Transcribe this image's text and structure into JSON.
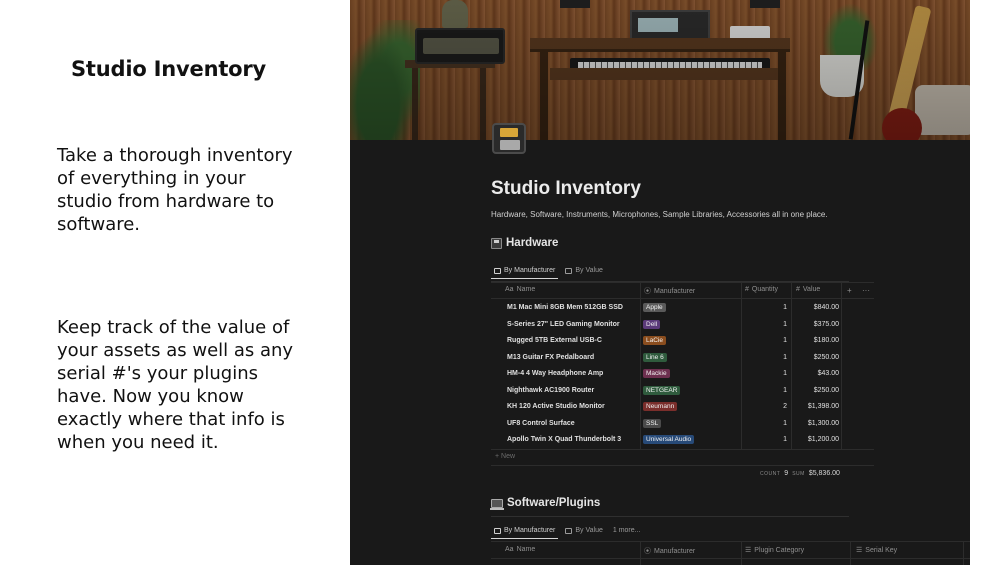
{
  "left": {
    "title": "Studio Inventory",
    "paragraph1": "Take a thorough inventory of everything in your studio from hardware to software.",
    "paragraph2": "Keep track of the value of your assets as well as any serial #'s your plugins have. Now you know exactly where that info is when you need it."
  },
  "page": {
    "title": "Studio Inventory",
    "description": "Hardware, Software, Instruments, Microphones, Sample Libraries, Accessories all in one place."
  },
  "hardware": {
    "heading": "Hardware",
    "tabs": [
      {
        "label": "By Manufacturer",
        "active": true
      },
      {
        "label": "By Value",
        "active": false
      }
    ],
    "columns": {
      "name": "Name",
      "manufacturer": "Manufacturer",
      "quantity": "Quantity",
      "value": "Value"
    },
    "rows": [
      {
        "name": "M1 Mac Mini 8GB Mem 512GB SSD",
        "manufacturer": "Apple",
        "tag_color": "#5a5a5a",
        "quantity": "1",
        "value": "$840.00"
      },
      {
        "name": "S-Series 27\" LED Gaming Monitor",
        "manufacturer": "Dell",
        "tag_color": "#5b3a7a",
        "quantity": "1",
        "value": "$375.00"
      },
      {
        "name": "Rugged 5TB External USB-C",
        "manufacturer": "LaCie",
        "tag_color": "#8a4d1e",
        "quantity": "1",
        "value": "$180.00"
      },
      {
        "name": "M13 Guitar FX Pedalboard",
        "manufacturer": "Line 6",
        "tag_color": "#2f5b3d",
        "quantity": "1",
        "value": "$250.00"
      },
      {
        "name": "HM-4 4 Way Headphone Amp",
        "manufacturer": "Mackie",
        "tag_color": "#6d2f4f",
        "quantity": "1",
        "value": "$43.00"
      },
      {
        "name": "Nighthawk AC1900 Router",
        "manufacturer": "NETGEAR",
        "tag_color": "#2f5b3d",
        "quantity": "1",
        "value": "$250.00"
      },
      {
        "name": "KH 120 Active Studio Monitor",
        "manufacturer": "Neumann",
        "tag_color": "#7a2e2b",
        "quantity": "2",
        "value": "$1,398.00"
      },
      {
        "name": "UF8 Control Surface",
        "manufacturer": "SSL",
        "tag_color": "#4a4a4a",
        "quantity": "1",
        "value": "$1,300.00"
      },
      {
        "name": "Apollo Twin X Quad Thunderbolt 3",
        "manufacturer": "Universal Audio",
        "tag_color": "#274a78",
        "quantity": "1",
        "value": "$1,200.00"
      }
    ],
    "new_label": "+ New",
    "count_label": "COUNT",
    "count_value": "9",
    "sum_label": "SUM",
    "sum_value": "$5,836.00"
  },
  "software": {
    "heading": "Software/Plugins",
    "tabs": [
      {
        "label": "By Manufacturer",
        "active": true
      },
      {
        "label": "By Value",
        "active": false
      },
      {
        "label": "1 more...",
        "active": false
      }
    ],
    "columns": {
      "name": "Name",
      "manufacturer": "Manufacturer",
      "category": "Plugin Category",
      "serial": "Serial Key"
    }
  },
  "icons": {
    "name_col": "Aa",
    "manufacturer_col": "⦿",
    "number_col": "#",
    "list_col": "☰",
    "add": "+",
    "more": "···"
  }
}
